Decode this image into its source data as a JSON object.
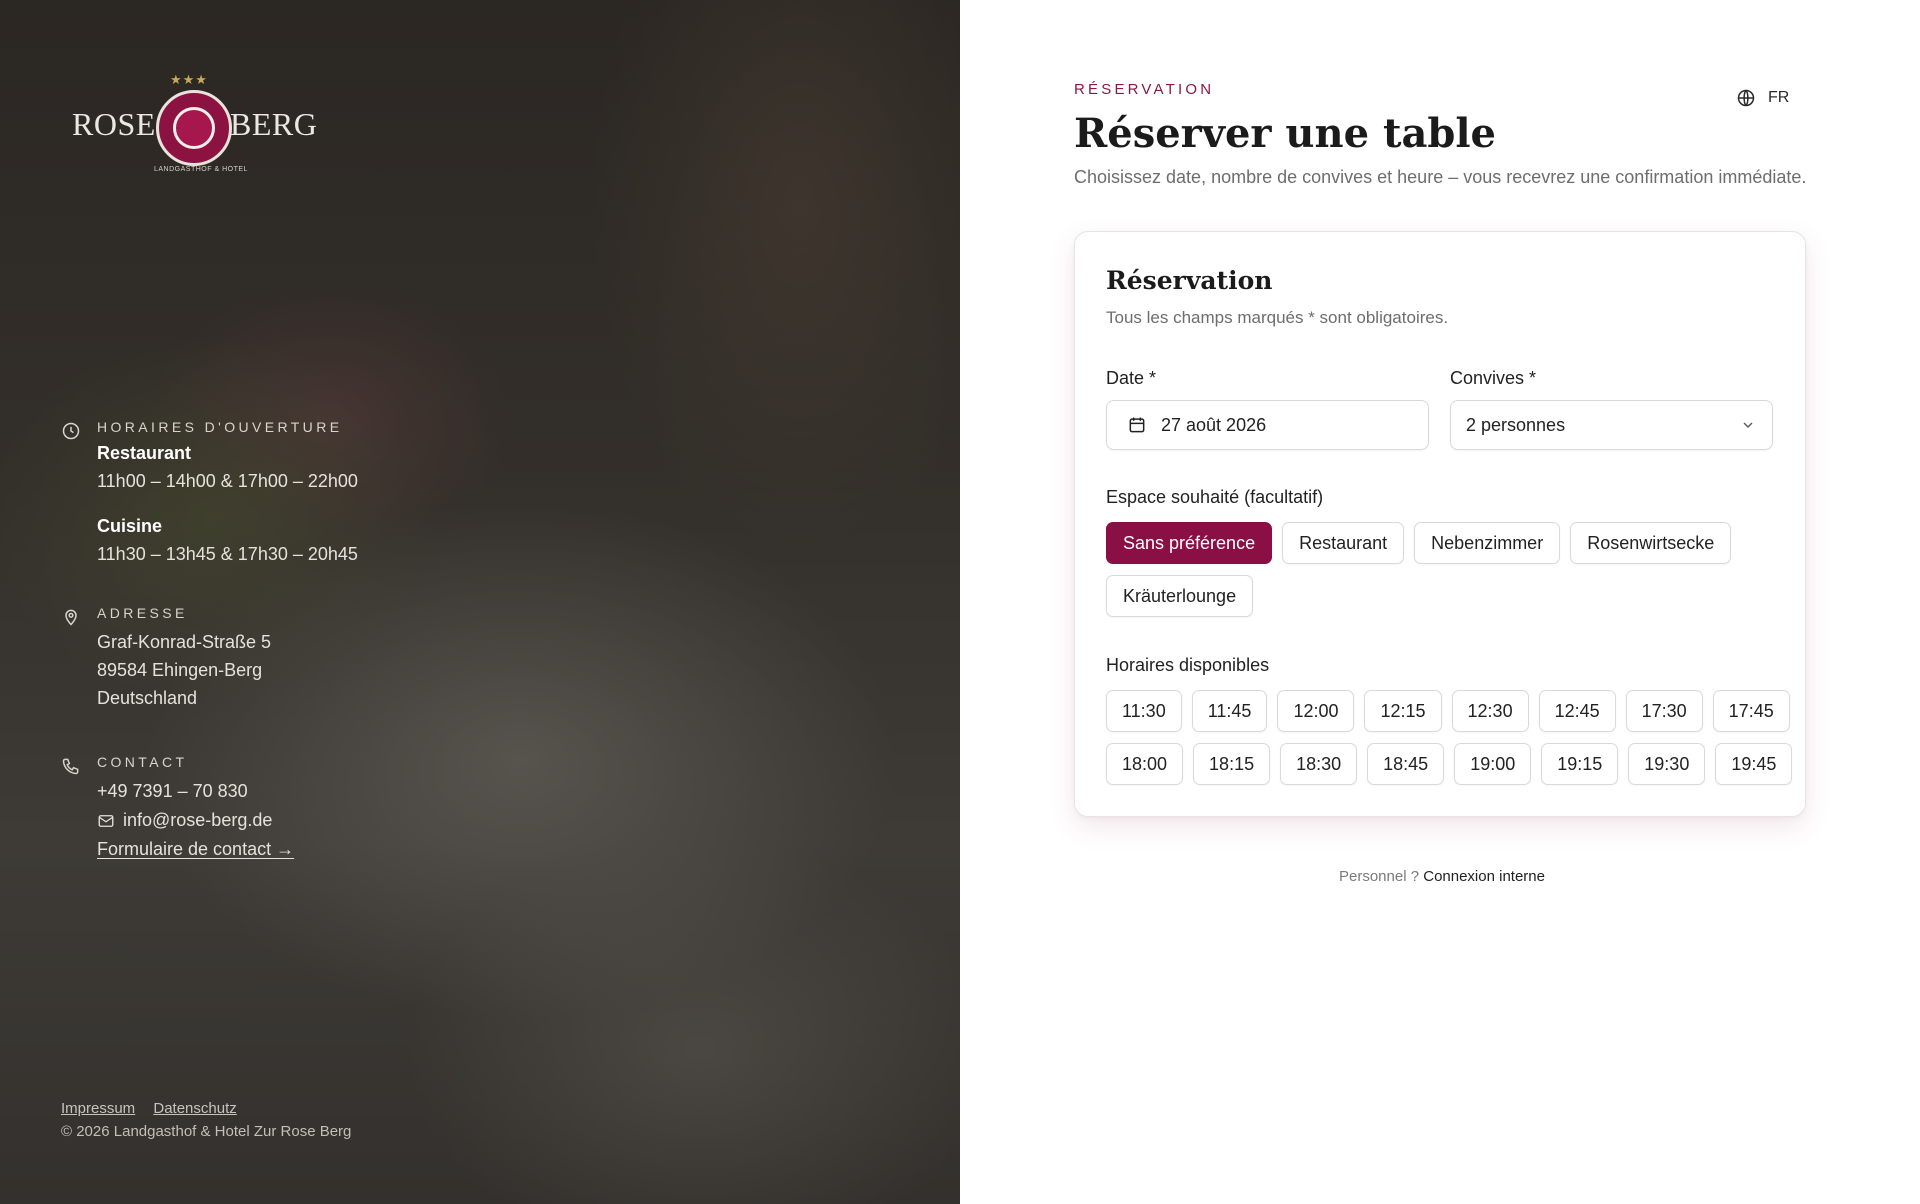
{
  "left": {
    "logo": {
      "stars": "★★★",
      "word_left": "ROSE",
      "word_right": "BERG",
      "seal_text": "LANDGASTHOF & HOTEL"
    },
    "hours": {
      "heading": "HORAIRES D'OUVERTURE",
      "restaurant_label": "Restaurant",
      "restaurant_hours": "11h00 – 14h00 & 17h00 – 22h00",
      "kitchen_label": "Cuisine",
      "kitchen_hours": "11h30 – 13h45 & 17h30 – 20h45"
    },
    "address": {
      "heading": "ADRESSE",
      "line1": "Graf-Konrad-Straße 5",
      "line2": "89584 Ehingen-Berg",
      "line3": "Deutschland"
    },
    "contact": {
      "heading": "CONTACT",
      "phone": "+49 7391 – 70 830",
      "email": "info@rose-berg.de",
      "form_link": "Formulaire de contact →"
    },
    "legal": {
      "impressum": "Impressum",
      "datenschutz": "Datenschutz",
      "copyright": "© 2026 Landgasthof & Hotel Zur Rose Berg"
    }
  },
  "right": {
    "eyebrow": "RÉSERVATION",
    "language": "FR",
    "title": "Réserver une table",
    "subtitle": "Choisissez date, nombre de convives et heure – vous recevrez une confirmation immédiate.",
    "card": {
      "title": "Réservation",
      "subtitle": "Tous les champs marqués * sont obligatoires.",
      "date_label": "Date *",
      "date_value": "27 août 2026",
      "guests_label": "Convives *",
      "guests_value": "2 personnes",
      "area_label": "Espace souhaité (facultatif)",
      "areas": [
        {
          "label": "Sans préférence",
          "selected": true
        },
        {
          "label": "Restaurant",
          "selected": false
        },
        {
          "label": "Nebenzimmer",
          "selected": false
        },
        {
          "label": "Rosenwirtsecke",
          "selected": false
        },
        {
          "label": "Kräuterlounge",
          "selected": false
        }
      ],
      "times_label": "Horaires disponibles",
      "times": [
        "11:30",
        "11:45",
        "12:00",
        "12:15",
        "12:30",
        "12:45",
        "17:30",
        "17:45",
        "18:00",
        "18:15",
        "18:30",
        "18:45",
        "19:00",
        "19:15",
        "19:30",
        "19:45"
      ]
    },
    "staff": {
      "prefix": "Personnel ?",
      "link": "Connexion interne"
    }
  },
  "colors": {
    "accent": "#8a0f45",
    "eyebrow": "#8a1744"
  }
}
